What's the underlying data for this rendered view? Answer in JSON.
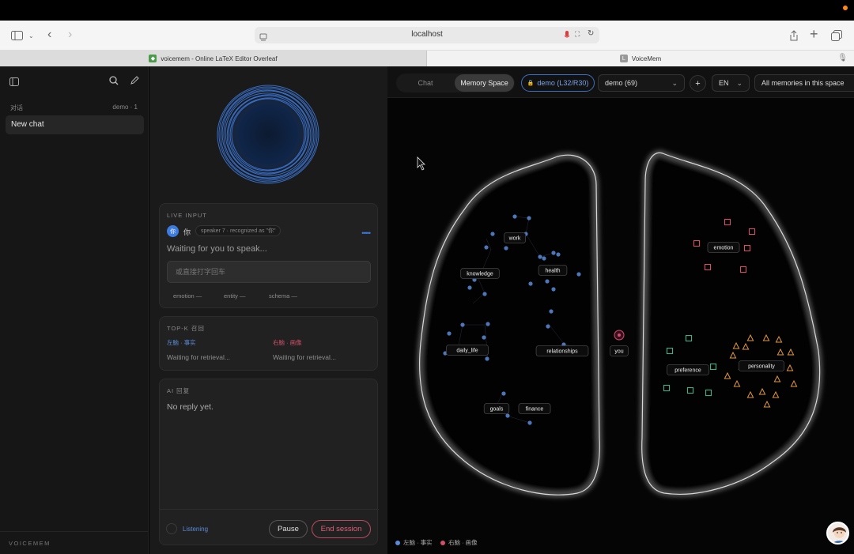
{
  "browser": {
    "url": "localhost",
    "tabs": [
      {
        "title": "voicemem - Online LaTeX Editor Overleaf"
      },
      {
        "title": "VoiceMem"
      }
    ]
  },
  "sidebar": {
    "section_label": "对话",
    "section_meta": "demo · 1",
    "new_chat": "New chat",
    "brand": "VOICEMEM"
  },
  "live_input": {
    "caption": "LIVE INPUT",
    "speaker_glyph": "你",
    "speaker_name": "你",
    "speaker_meta": "speaker 7 · recognized as \"你\"",
    "status": "Waiting for you to speak...",
    "input_placeholder": "或直接打字回车",
    "tags": [
      "emotion —",
      "entity —",
      "schema —"
    ]
  },
  "topk": {
    "caption": "TOP-K 召回",
    "left_title": "左脑 · 事实",
    "right_title": "右脑 · 画像",
    "left_status": "Waiting for retrieval...",
    "right_status": "Waiting for retrieval..."
  },
  "ai_reply": {
    "caption": "AI 回复",
    "text": "No reply yet."
  },
  "controls": {
    "listening": "Listening",
    "pause": "Pause",
    "end": "End session"
  },
  "memory_bar": {
    "tab_chat": "Chat",
    "tab_memory": "Memory Space",
    "badge": "demo (L32/R30)",
    "space_select": "demo (69)",
    "add": "+",
    "lang": "EN",
    "scope": "All memories in this space"
  },
  "brain": {
    "left_labels": [
      "work",
      "knowledge",
      "health",
      "daily_life",
      "relationships",
      "goals",
      "finance"
    ],
    "right_labels": [
      "emotion",
      "preference",
      "personality"
    ],
    "center_label": "you"
  },
  "legend": {
    "left": "左脑 · 事实",
    "right": "右脑 · 画像"
  },
  "colors": {
    "left_brain": "#5b8bd9",
    "emotion": "#d0506a",
    "preference": "#3fae8a",
    "personality": "#e09540",
    "accent_blue": "#3d7be0",
    "end_session": "#e0607a"
  }
}
